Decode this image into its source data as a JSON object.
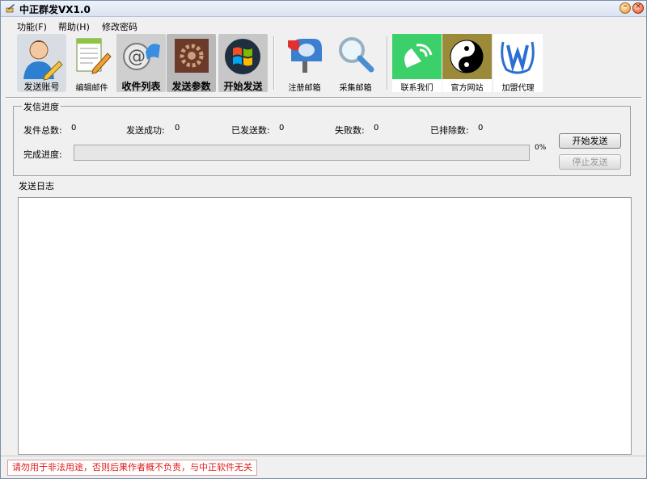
{
  "window": {
    "title": "中正群发VX1.0"
  },
  "menu": [
    {
      "label": "功能(F)"
    },
    {
      "label": "帮助(H)"
    },
    {
      "label": "修改密码"
    }
  ],
  "toolbar": {
    "send_account": "发送账号",
    "edit_mail": "编辑邮件",
    "recipient_list": "收件列表",
    "send_params": "发送参数",
    "start_send": "开始发送",
    "register_mailbox": "注册邮箱",
    "collect_mailbox": "采集邮箱",
    "contact_us": "联系我们",
    "official_site": "官方网站",
    "join_agent": "加盟代理"
  },
  "progress_group": {
    "title": "发信进度",
    "stats": [
      {
        "label": "发件总数:",
        "value": "0"
      },
      {
        "label": "发送成功:",
        "value": "0"
      },
      {
        "label": "已发送数:",
        "value": "0"
      },
      {
        "label": "失败数:",
        "value": "0"
      },
      {
        "label": "已排除数:",
        "value": "0"
      }
    ],
    "progress_label": "完成进度:",
    "progress_value": 0,
    "progress_text": "0%",
    "start_button": "开始发送",
    "stop_button": "停止发送"
  },
  "log": {
    "label": "发送日志",
    "content": ""
  },
  "status": {
    "warning": "请勿用于非法用途，否则后果作者概不负责，与中正软件无关"
  },
  "colors": {
    "progress_fill": "#3db83d",
    "warning_text": "#e01b1b",
    "title_bar": "#dde6f3"
  }
}
